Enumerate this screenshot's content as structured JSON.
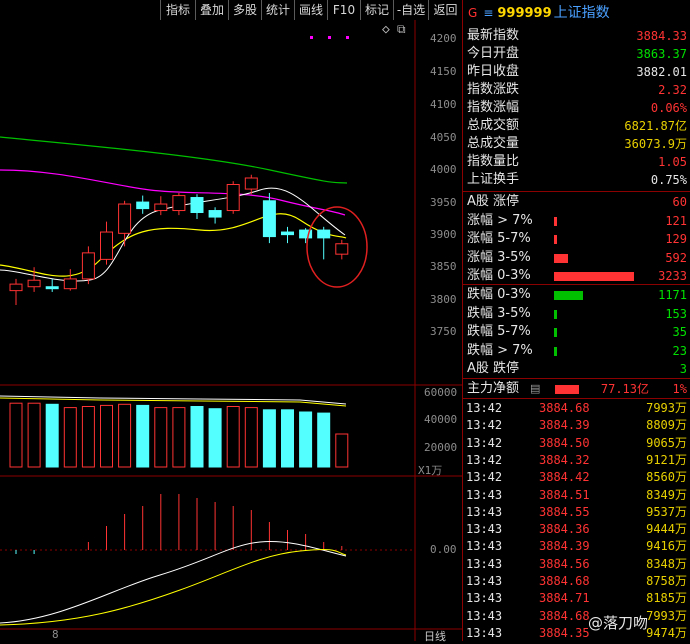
{
  "toolbar": {
    "buttons": [
      "指标",
      "叠加",
      "多股",
      "统计",
      "画线",
      "F10",
      "标记",
      "-自选",
      "返回"
    ]
  },
  "main_chart": {
    "price_axis": [
      "4200",
      "4150",
      "4100",
      "4050",
      "4000",
      "3950",
      "3900",
      "3850",
      "3800",
      "3750"
    ],
    "volume_axis": [
      "60000",
      "40000",
      "20000",
      "X1万"
    ],
    "macd_axis": [
      "0.00"
    ],
    "bottom_label": "日线",
    "date_marker": "8"
  },
  "chart_data": {
    "type": "candlestick",
    "price_range": [
      3720,
      4220
    ],
    "candles": [
      {
        "o": 3812,
        "c": 3822,
        "h": 3830,
        "l": 3790
      },
      {
        "o": 3818,
        "c": 3828,
        "h": 3848,
        "l": 3810
      },
      {
        "o": 3818,
        "c": 3815,
        "h": 3830,
        "l": 3810
      },
      {
        "o": 3815,
        "c": 3830,
        "h": 3845,
        "l": 3812
      },
      {
        "o": 3830,
        "c": 3870,
        "h": 3880,
        "l": 3822
      },
      {
        "o": 3860,
        "c": 3902,
        "h": 3918,
        "l": 3852
      },
      {
        "o": 3900,
        "c": 3945,
        "h": 3950,
        "l": 3880
      },
      {
        "o": 3948,
        "c": 3938,
        "h": 3958,
        "l": 3930
      },
      {
        "o": 3935,
        "c": 3945,
        "h": 3957,
        "l": 3928
      },
      {
        "o": 3935,
        "c": 3958,
        "h": 3962,
        "l": 3928
      },
      {
        "o": 3955,
        "c": 3932,
        "h": 3960,
        "l": 3922
      },
      {
        "o": 3935,
        "c": 3925,
        "h": 3940,
        "l": 3915
      },
      {
        "o": 3935,
        "c": 3975,
        "h": 3980,
        "l": 3930
      },
      {
        "o": 3968,
        "c": 3985,
        "h": 3990,
        "l": 3960
      },
      {
        "o": 3950,
        "c": 3895,
        "h": 3962,
        "l": 3885
      },
      {
        "o": 3902,
        "c": 3898,
        "h": 3910,
        "l": 3885
      },
      {
        "o": 3905,
        "c": 3893,
        "h": 3908,
        "l": 3885
      },
      {
        "o": 3905,
        "c": 3893,
        "h": 3910,
        "l": 3860
      },
      {
        "o": 3868,
        "c": 3884,
        "h": 3890,
        "l": 3860
      }
    ],
    "volume_range": [
      0,
      70000
    ],
    "volumes": [
      58000,
      58000,
      57000,
      54000,
      55000,
      56000,
      57000,
      56000,
      54000,
      54000,
      55000,
      53000,
      55000,
      54000,
      52000,
      52000,
      50000,
      49000,
      30000
    ],
    "macd_bars": [
      -1,
      -1,
      0,
      0,
      2,
      6,
      9,
      11,
      14,
      14,
      13,
      12,
      11,
      10,
      7,
      5,
      4,
      2,
      1
    ]
  },
  "info": {
    "market_letter": "G",
    "menu_icon": "menu-icon",
    "code": "999999",
    "name": "上证指数",
    "rows": [
      {
        "label": "最新指数",
        "value": "3884.33",
        "color": "red"
      },
      {
        "label": "今日开盘",
        "value": "3863.37",
        "color": "green"
      },
      {
        "label": "昨日收盘",
        "value": "3882.01",
        "color": "white"
      },
      {
        "label": "指数涨跌",
        "value": "2.32",
        "color": "red"
      },
      {
        "label": "指数涨幅",
        "value": "0.06%",
        "color": "red"
      },
      {
        "label": "总成交额",
        "value": "6821.87亿",
        "color": "yellow"
      },
      {
        "label": "总成交量",
        "value": "36073.9万",
        "color": "yellow"
      },
      {
        "label": "指数量比",
        "value": "1.05",
        "color": "red"
      },
      {
        "label": "上证换手",
        "value": "0.75%",
        "color": "white"
      }
    ],
    "up_rows": [
      {
        "label": "A股 涨停",
        "value": "60",
        "frac": 0.0
      },
      {
        "label": "涨幅 > 7%",
        "value": "121",
        "frac": 0.02
      },
      {
        "label": "涨幅 5-7%",
        "value": "129",
        "frac": 0.02
      },
      {
        "label": "涨幅 3-5%",
        "value": "592",
        "frac": 0.18
      },
      {
        "label": "涨幅 0-3%",
        "value": "3233",
        "frac": 1.0
      }
    ],
    "down_rows": [
      {
        "label": "跌幅 0-3%",
        "value": "1171",
        "frac": 0.36
      },
      {
        "label": "跌幅 3-5%",
        "value": "153",
        "frac": 0.03
      },
      {
        "label": "跌幅 5-7%",
        "value": "35",
        "frac": 0.01
      },
      {
        "label": "跌幅 > 7%",
        "value": "23",
        "frac": 0.01
      },
      {
        "label": "A股 跌停",
        "value": "3",
        "frac": 0.0
      }
    ],
    "main_flow": {
      "label": "主力净额",
      "value": "77.13亿",
      "pct": "1%"
    }
  },
  "ticks": [
    {
      "time": "13:42",
      "price": "3884.68",
      "vol": "7993万"
    },
    {
      "time": "13:42",
      "price": "3884.39",
      "vol": "8809万"
    },
    {
      "time": "13:42",
      "price": "3884.50",
      "vol": "9065万"
    },
    {
      "time": "13:42",
      "price": "3884.32",
      "vol": "9121万"
    },
    {
      "time": "13:42",
      "price": "3884.42",
      "vol": "8560万"
    },
    {
      "time": "13:43",
      "price": "3884.51",
      "vol": "8349万"
    },
    {
      "time": "13:43",
      "price": "3884.55",
      "vol": "9537万"
    },
    {
      "time": "13:43",
      "price": "3884.36",
      "vol": "9444万"
    },
    {
      "time": "13:43",
      "price": "3884.39",
      "vol": "9416万"
    },
    {
      "time": "13:43",
      "price": "3884.56",
      "vol": "8348万"
    },
    {
      "time": "13:43",
      "price": "3884.68",
      "vol": "8758万"
    },
    {
      "time": "13:43",
      "price": "3884.71",
      "vol": "8185万"
    },
    {
      "time": "13:43",
      "price": "3884.68",
      "vol": "7993万"
    },
    {
      "time": "13:43",
      "price": "3884.35",
      "vol": "9474万"
    }
  ],
  "watermark": "@落刀吻",
  "colors": {
    "up": "#ff3333",
    "down": "#54ffff",
    "ma5": "#ffffff",
    "ma10": "#ffff00",
    "ma20": "#ff00ff",
    "ma60": "#00c000"
  }
}
